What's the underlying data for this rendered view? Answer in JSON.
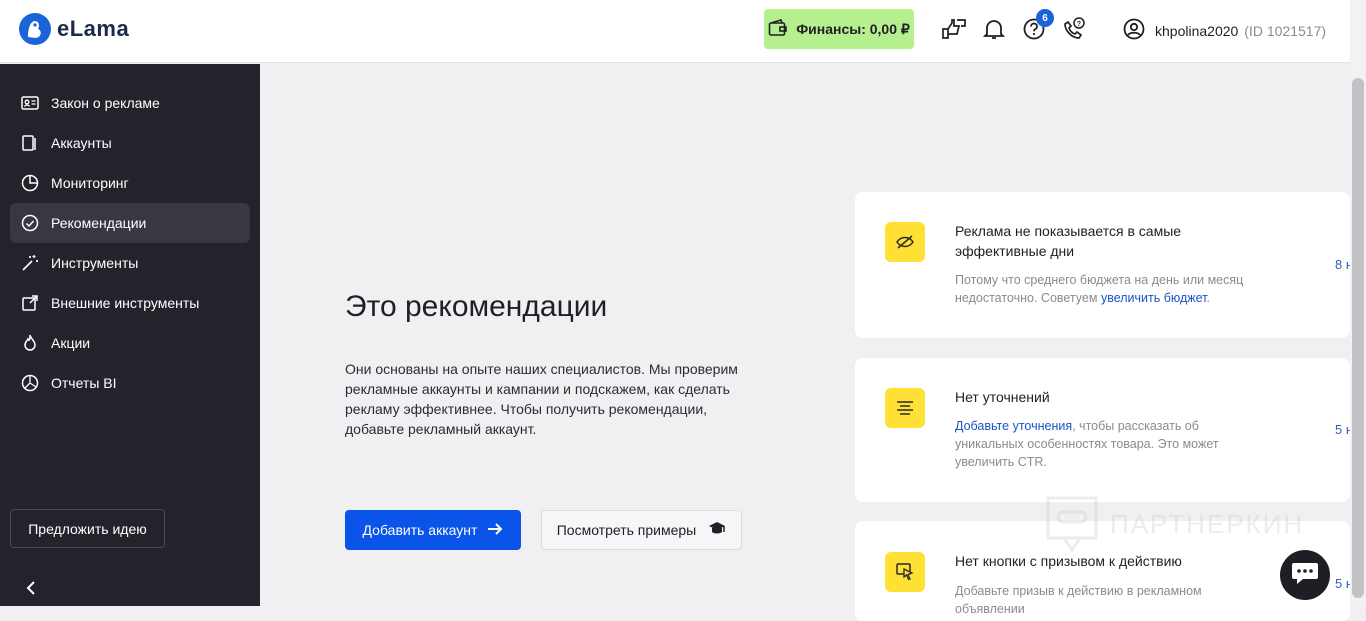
{
  "header": {
    "logo_text": "eLama",
    "finance_label": "Финансы: 0,00 ₽",
    "notifications_badge": "6",
    "username": "khpolina2020",
    "user_id": "(ID 1021517)",
    "icons": [
      "wallet-icon",
      "thumbs-icon",
      "bell-icon",
      "help-icon",
      "phone-help-icon",
      "user-icon"
    ]
  },
  "sidebar": {
    "items": [
      {
        "label": "Закон о рекламе",
        "icon": "id-card-icon"
      },
      {
        "label": "Аккаунты",
        "icon": "accounts-icon"
      },
      {
        "label": "Мониторинг",
        "icon": "pie-chart-icon"
      },
      {
        "label": "Рекомендации",
        "icon": "check-circle-icon",
        "active": true
      },
      {
        "label": "Инструменты",
        "icon": "magic-wand-icon"
      },
      {
        "label": "Внешние инструменты",
        "icon": "external-link-icon"
      },
      {
        "label": "Акции",
        "icon": "fire-icon"
      },
      {
        "label": "Отчеты BI",
        "icon": "chart-circle-icon"
      }
    ],
    "idea_button": "Предложить идею"
  },
  "main": {
    "title": "Это рекомендации",
    "description": "Они основаны на опыте наших специалистов. Мы проверим рекламные аккаунты и кампании и подскажем, как сделать рекламу эффективнее. Чтобы получить рекомендации, добавьте рекламный аккаунт.",
    "add_account_button": "Добавить аккаунт",
    "examples_button": "Посмотреть примеры"
  },
  "cards": [
    {
      "title": "Реклама не показывается в самые эффективные дни",
      "text_before": "Потому что среднего бюджета на день или месяц недостаточно. Советуем ",
      "link": "увеличить бюджет",
      "text_after": ".",
      "count": "8 н",
      "icon": "eye-off-icon"
    },
    {
      "title": "Нет уточнений",
      "text_before": "",
      "link": "Добавьте уточнения",
      "text_after": ", чтобы рассказать об уникальных особенностях товара. Это может увеличить CTR.",
      "count": "5 н",
      "icon": "text-lines-icon"
    },
    {
      "title": "Нет кнопки с призывом к действию",
      "text_before": "Добавьте призыв к действию в рекламном объявлении",
      "link": "",
      "text_after": "",
      "count": "5 н",
      "icon": "cursor-click-icon"
    }
  ],
  "watermark": "ПАРТНЕРКИН",
  "colors": {
    "sidebar_bg": "#23232b",
    "primary": "#0a54ea",
    "finance_bg": "#b6f08e",
    "card_icon_bg": "#ffe034",
    "link": "#1a55c4"
  }
}
